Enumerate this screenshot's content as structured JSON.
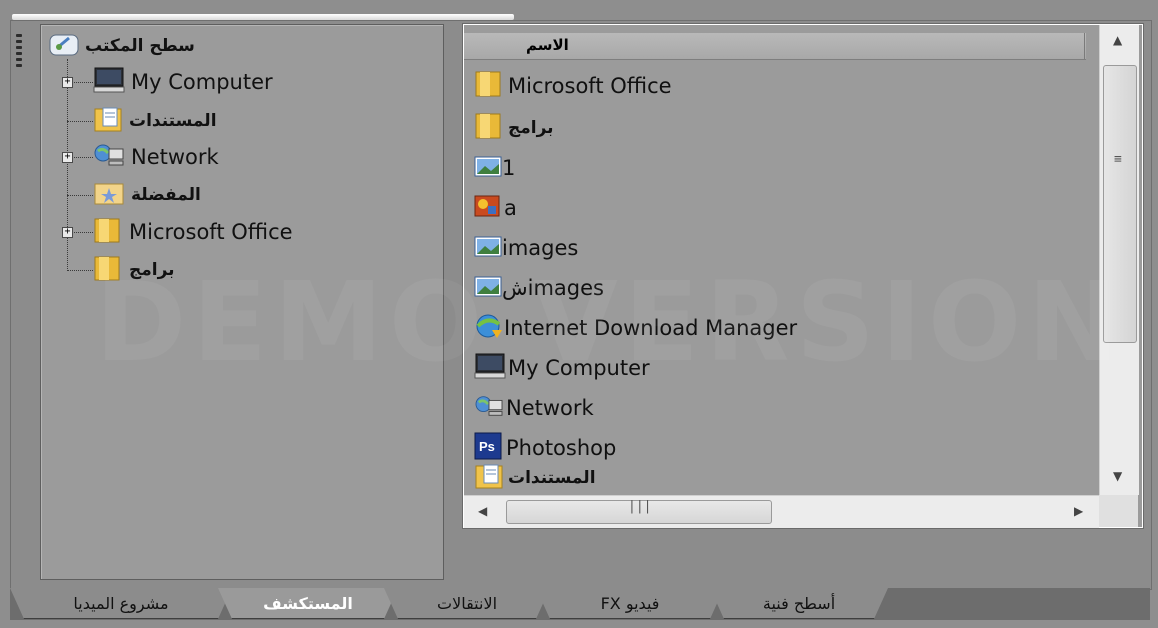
{
  "tree": {
    "root_label": "سطح المكتب",
    "items": [
      {
        "label": "My Computer",
        "icon": "computer-icon",
        "expandable": true
      },
      {
        "label": "المستندات",
        "icon": "documents-folder-icon",
        "expandable": false
      },
      {
        "label": "Network",
        "icon": "network-icon",
        "expandable": true
      },
      {
        "label": "المفضلة",
        "icon": "favorites-folder-icon",
        "expandable": false
      },
      {
        "label": "Microsoft Office",
        "icon": "folder-icon",
        "expandable": true
      },
      {
        "label": "برامج",
        "icon": "folder-icon",
        "expandable": false
      }
    ]
  },
  "list": {
    "column_header": "الاسم",
    "items": [
      {
        "label": "Microsoft Office",
        "icon": "folder-icon"
      },
      {
        "label": "برامج",
        "icon": "folder-icon"
      },
      {
        "label": "1",
        "icon": "image-file-icon"
      },
      {
        "label": "a",
        "icon": "photo-file-icon"
      },
      {
        "label": "images",
        "icon": "image-file-icon"
      },
      {
        "label": "شimages",
        "icon": "image-file-icon"
      },
      {
        "label": "Internet Download Manager",
        "icon": "idm-icon"
      },
      {
        "label": "My Computer",
        "icon": "computer-icon"
      },
      {
        "label": "Network",
        "icon": "network-icon"
      },
      {
        "label": "Photoshop",
        "icon": "photoshop-icon"
      },
      {
        "label": "المستندات",
        "icon": "documents-folder-icon"
      }
    ]
  },
  "tabs": [
    {
      "label": "مشروع الميديا",
      "active": false
    },
    {
      "label": "المستكشف",
      "active": true
    },
    {
      "label": "الانتقالات",
      "active": false
    },
    {
      "label": "فيديو FX",
      "active": false
    },
    {
      "label": "أسطح فنية",
      "active": false
    }
  ],
  "watermark": "DEMO VERSION",
  "colors": {
    "pane_bg": "#9b9b9b",
    "window_bg": "#8e8e8e",
    "active_tab_text": "#ffffff",
    "scrollbar_bg": "#ececec"
  }
}
